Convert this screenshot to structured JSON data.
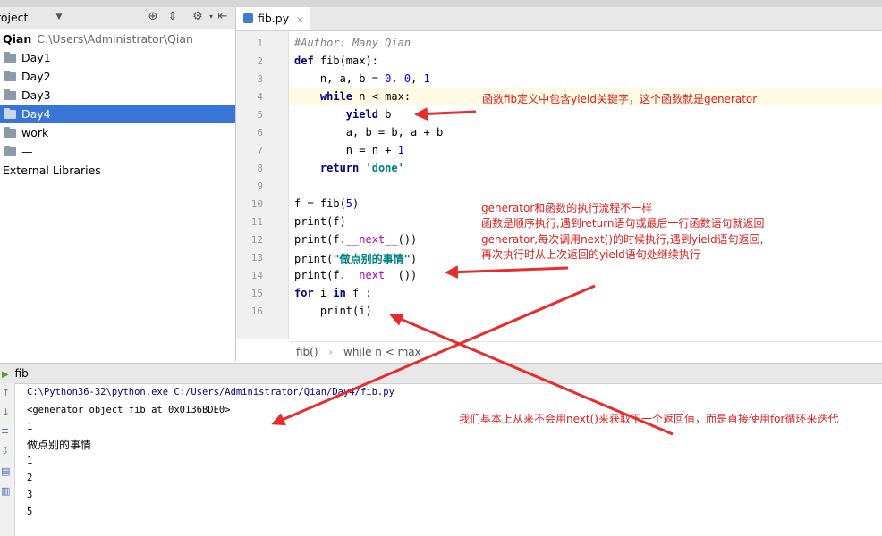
{
  "project": {
    "title": "roject",
    "root_name": "Qian",
    "root_path": "C:\\Users\\Administrator\\Qian",
    "folders": [
      "Day1",
      "Day2",
      "Day3",
      "Day4",
      "work",
      "—"
    ],
    "external": "External Libraries",
    "selected": "Day4"
  },
  "editor": {
    "tab_label": "fib.py",
    "breadcrumb": [
      "fib()",
      "while n < max"
    ]
  },
  "run": {
    "tab_label": "fib",
    "output": [
      "C:\\Python36-32\\python.exe C:/Users/Administrator/Qian/Day4/fib.py",
      "<generator object fib at 0x0136BDE0>",
      "1",
      "做点别的事情",
      "1",
      "2",
      "3",
      "5"
    ]
  },
  "annotations": {
    "a1": "函数fib定义中包含yield关键字，这个函数就是generator",
    "a2": [
      "generator和函数的执行流程不一样",
      "函数是顺序执行,遇到return语句或最后一行函数语句就返回",
      "generator,每次调用next()的时候执行,遇到yield语句返回,",
      "再次执行时从上次返回的yield语句处继续执行"
    ],
    "a3": "我们基本上从来不会用next()来获取下一个返回值，而是直接使用for循环来迭代"
  },
  "colors": {
    "selection": "#3875d7",
    "annotation": "#e02020",
    "keyword": "#000080",
    "number": "#0000ff",
    "string": "#008080"
  }
}
